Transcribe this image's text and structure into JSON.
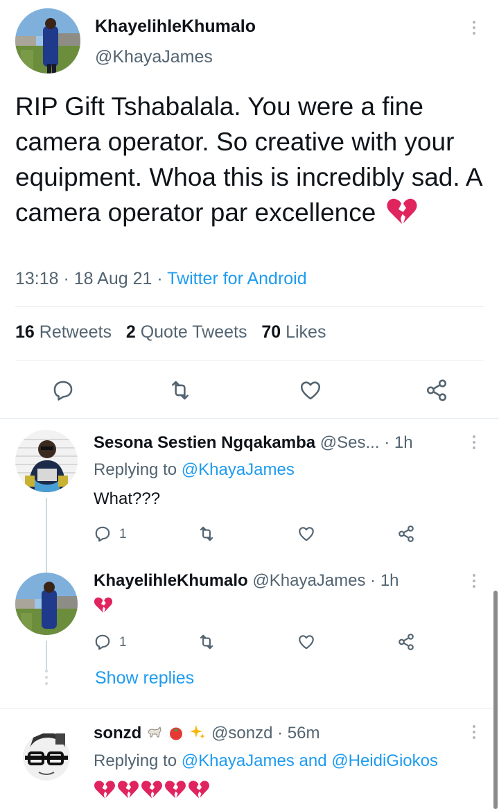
{
  "main_tweet": {
    "display_name": "KhayelihleKhumalo",
    "handle": "@KhayaJames",
    "text": "RIP Gift Tshabalala. You were a fine camera operator. So creative with your equipment. Whoa this is incredibly sad. A camera operator par excellence",
    "emoji": "broken-heart",
    "time_date": "13:18 · 18 Aug 21 · ",
    "source": "Twitter for Android",
    "retweets_count": "16",
    "retweets_label": "Retweets",
    "quote_count": "2",
    "quote_label": "Quote Tweets",
    "likes_count": "70",
    "likes_label": "Likes"
  },
  "replies": [
    {
      "display_name": "Sesona Sestien Ngqakamba",
      "handle": "@Ses...",
      "time": "· 1h",
      "replying_prefix": "Replying to ",
      "replying_to": "@KhayaJames",
      "text": "What???",
      "reply_count": "1"
    },
    {
      "display_name": "KhayelihleKhumalo",
      "handle": "@KhayaJames",
      "time": "· 1h",
      "emoji": "broken-heart",
      "reply_count": "1",
      "show_replies": "Show replies"
    },
    {
      "display_name": "sonzd",
      "name_emojis": [
        "goat",
        "tomato",
        "sparkles"
      ],
      "handle": "@sonzd",
      "time": "· 56m",
      "replying_prefix": "Replying to ",
      "replying_to_1": "@KhayaJames",
      "replying_and": " and ",
      "replying_to_2": "@HeidiGiokos",
      "emojis": [
        "broken-heart",
        "broken-heart",
        "broken-heart",
        "broken-heart",
        "broken-heart"
      ]
    }
  ],
  "colors": {
    "accent": "#1d9bf0",
    "text": "#0f1419",
    "secondary": "#536471",
    "heart": "#e0245e"
  }
}
